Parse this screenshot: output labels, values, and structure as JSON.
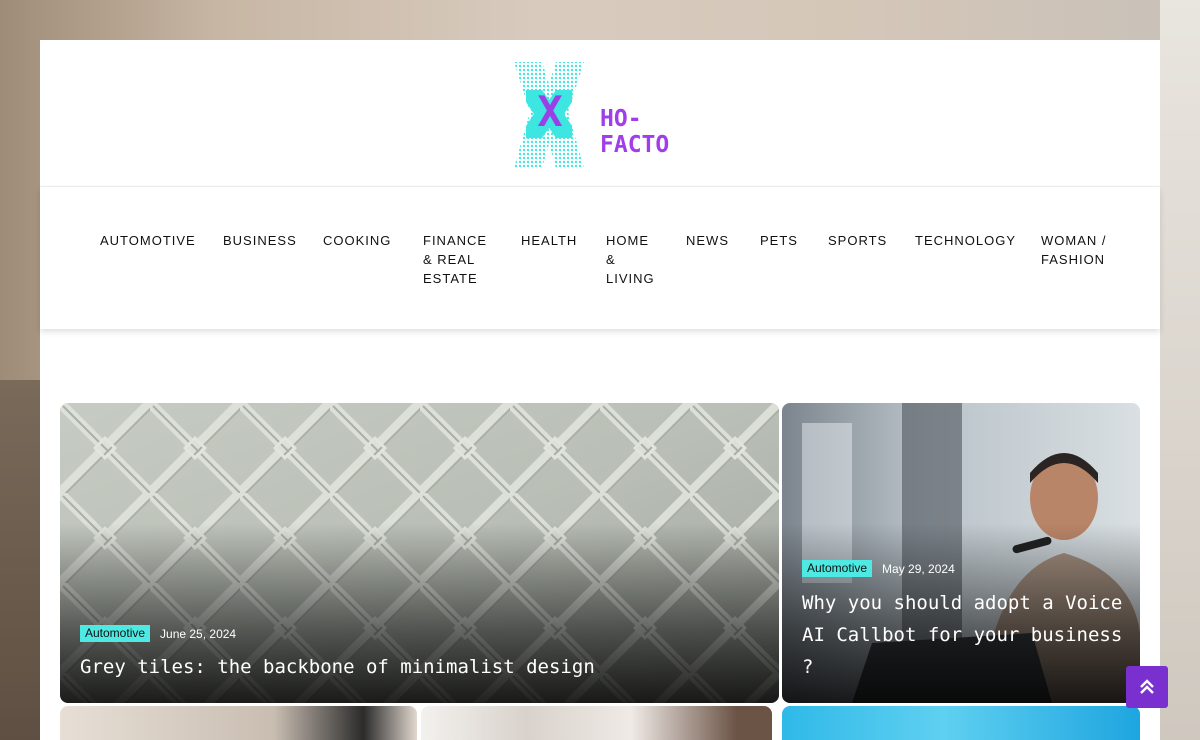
{
  "site": {
    "name": "HO-FACTO",
    "logo_letter": "X"
  },
  "nav": {
    "items": [
      {
        "label": "AUTOMOTIVE"
      },
      {
        "label": "BUSINESS"
      },
      {
        "label": "COOKING"
      },
      {
        "label": "FINANCE & REAL ESTATE"
      },
      {
        "label": "HEALTH"
      },
      {
        "label": "HOME & LIVING"
      },
      {
        "label": "NEWS"
      },
      {
        "label": "PETS"
      },
      {
        "label": "SPORTS"
      },
      {
        "label": "TECHNOLOGY"
      },
      {
        "label": "WOMAN / FASHION"
      }
    ]
  },
  "featured": [
    {
      "category": "Automotive",
      "date": "June 25, 2024",
      "title": "Grey tiles: the backbone of minimalist design"
    },
    {
      "category": "Automotive",
      "date": "May 29, 2024",
      "title": "Why you should adopt a Voice AI Callbot for your business ?"
    }
  ],
  "colors": {
    "accent": "#a13ee8",
    "badge": "#4ee9e2",
    "scroll_button": "#7a2fcf"
  },
  "icons": {
    "scroll_top": "double-chevron-up-icon"
  }
}
